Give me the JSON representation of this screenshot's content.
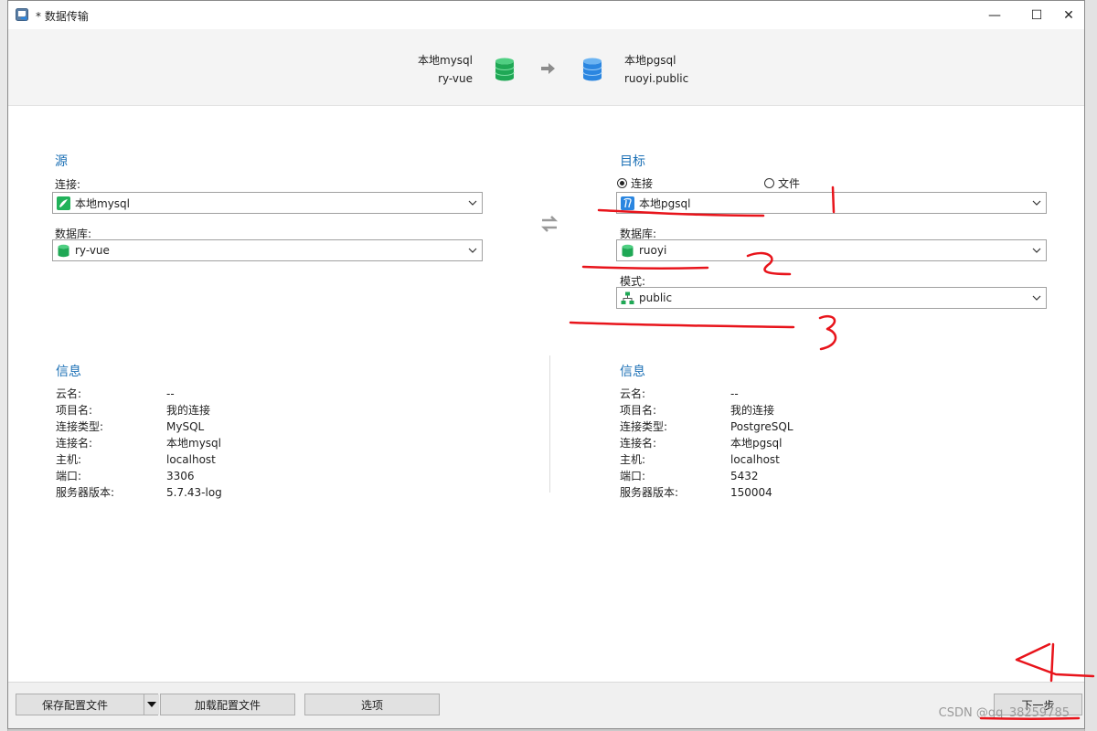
{
  "window": {
    "title": "* 数据传输",
    "controls": {
      "minimize": "—",
      "maximize": "☐",
      "close": "✕"
    }
  },
  "header": {
    "source": {
      "connection": "本地mysql",
      "database": "ry-vue"
    },
    "target": {
      "connection": "本地pgsql",
      "database": "ruoyi.public"
    }
  },
  "source": {
    "title": "源",
    "connection_label": "连接:",
    "connection_value": "本地mysql",
    "database_label": "数据库:",
    "database_value": "ry-vue"
  },
  "target": {
    "title": "目标",
    "radio_connection": "连接",
    "radio_file": "文件",
    "radio_selected": "连接",
    "connection_value": "本地pgsql",
    "database_label": "数据库:",
    "database_value": "ruoyi",
    "schema_label": "模式:",
    "schema_value": "public"
  },
  "source_info": {
    "title": "信息",
    "rows": [
      {
        "key": "云名:",
        "value": "--"
      },
      {
        "key": "项目名:",
        "value": "我的连接"
      },
      {
        "key": "连接类型:",
        "value": "MySQL"
      },
      {
        "key": "连接名:",
        "value": "本地mysql"
      },
      {
        "key": "主机:",
        "value": "localhost"
      },
      {
        "key": "端口:",
        "value": "3306"
      },
      {
        "key": "服务器版本:",
        "value": "5.7.43-log"
      }
    ]
  },
  "target_info": {
    "title": "信息",
    "rows": [
      {
        "key": "云名:",
        "value": "--"
      },
      {
        "key": "项目名:",
        "value": "我的连接"
      },
      {
        "key": "连接类型:",
        "value": "PostgreSQL"
      },
      {
        "key": "连接名:",
        "value": "本地pgsql"
      },
      {
        "key": "主机:",
        "value": "localhost"
      },
      {
        "key": "端口:",
        "value": "5432"
      },
      {
        "key": "服务器版本:",
        "value": "150004"
      }
    ]
  },
  "footer": {
    "save_profile": "保存配置文件",
    "load_profile": "加载配置文件",
    "options": "选项",
    "next": "下一步",
    "watermark": "CSDN @qq_38259785"
  },
  "colors": {
    "accent": "#1a6fb5",
    "mysql_green": "#1fa855",
    "pgsql_blue": "#2b86e0",
    "annotation_red": "#e8141b"
  }
}
